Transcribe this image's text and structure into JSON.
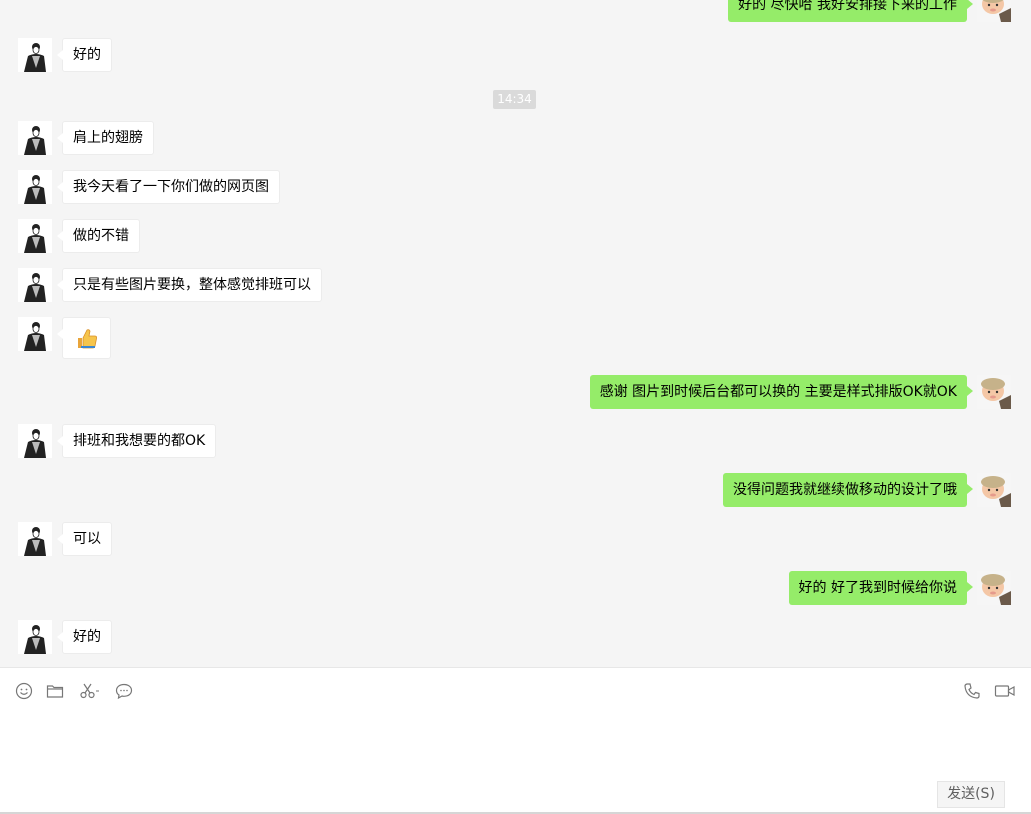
{
  "chat": {
    "timestamp": "14:34",
    "messages": [
      {
        "side": "right",
        "text": "好的 尽快哈 我好安排接下来的工作"
      },
      {
        "side": "left",
        "text": "好的"
      },
      {
        "side": "left",
        "text": "肩上的翅膀"
      },
      {
        "side": "left",
        "text": "我今天看了一下你们做的网页图"
      },
      {
        "side": "left",
        "text": "做的不错"
      },
      {
        "side": "left",
        "text": "只是有些图片要换，整体感觉排班可以"
      },
      {
        "side": "left",
        "text": "",
        "emoji": "thumbs-up-icon"
      },
      {
        "side": "right",
        "text": "感谢  图片到时候后台都可以换的 主要是样式排版OK就OK"
      },
      {
        "side": "left",
        "text": "排班和我想要的都OK"
      },
      {
        "side": "right",
        "text": "没得问题我就继续做移动的设计了哦"
      },
      {
        "side": "left",
        "text": "可以"
      },
      {
        "side": "right",
        "text": "好的 好了我到时候给你说"
      },
      {
        "side": "left",
        "text": "好的"
      }
    ]
  },
  "toolbar": {
    "left_icons": [
      "emoji-icon",
      "folder-icon",
      "scissors-icon",
      "chat-bubble-icon"
    ],
    "right_icons": [
      "phone-icon",
      "video-call-icon"
    ]
  },
  "input": {
    "value": "",
    "send_label": "发送(S)"
  },
  "colors": {
    "chat_bg": "#f5f5f5",
    "own_bubble": "#95ec69",
    "other_bubble": "#ffffff"
  }
}
